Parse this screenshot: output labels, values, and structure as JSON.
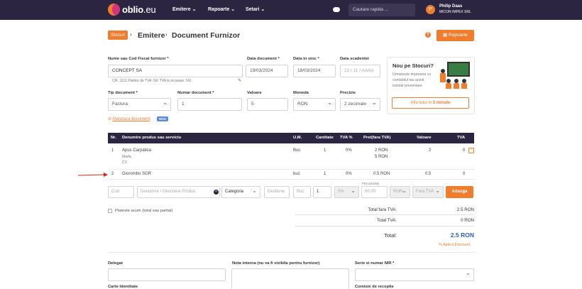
{
  "app": {
    "name": "oblio",
    "tld": ".eu"
  },
  "nav": {
    "items": [
      "Emitere",
      "Rapoarte",
      "Setari"
    ]
  },
  "search": {
    "placeholder": "Cautare rapida ..."
  },
  "user": {
    "initial": "P",
    "name": "Philip Daas",
    "company": "MICON IMPEX SRL"
  },
  "breadcrumb": {
    "badge": "Stocuri",
    "level1": "Emitere",
    "level2": "Document Furnizor"
  },
  "header": {
    "reports_button": "Rapoarte",
    "help": "?"
  },
  "form": {
    "supplier_label": "Nume sau Cod Fiscal furnizor *",
    "supplier_value": "CONCEPT SA",
    "supplier_hint": "CIF: 1111   Platitor de TVA: NU   TVA la incasare: NU",
    "doc_date_label": "Data document *",
    "doc_date_value": "19/03/2024",
    "stock_date_label": "Data in stoc *",
    "stock_date_value": "18/03/2024",
    "due_date_label": "Data scadentei",
    "due_date_placeholder": "22 / 11 / AAAA",
    "doc_type_label": "Tip document *",
    "doc_type_value": "Factura",
    "doc_number_label": "Numar document *",
    "doc_number_value": "1",
    "value_label": "Valoare",
    "value_value": "5",
    "currency_label": "Moneda",
    "currency_value": "RON",
    "precision_label": "Precizie",
    "precision_value": "2 zecimale"
  },
  "promo": {
    "title": "Nou pe Stocuri?",
    "text": "Urmareste impreuna cu contabilul tau acest tutorial prezentare",
    "button_prefix": "Afla totul in",
    "button_highlight": "5 minute"
  },
  "attach": {
    "label": "Ataseaza document",
    "badge": "NOU"
  },
  "table": {
    "headers": [
      "Nr.",
      "Denumire produs sau serviciu",
      "U.M.",
      "Cantitate",
      "TVA %",
      "Pret(fara TVA)",
      "Valoare",
      "TVA"
    ],
    "rows": [
      {
        "nr": "1",
        "name": "Apus Carpatica",
        "details": [
          "Marfa",
          "CV"
        ],
        "um": "Buc",
        "qty": "1",
        "vat_pct": "0%",
        "price": "2 RON",
        "price2": "5 RON",
        "value": "2",
        "vat": "0"
      },
      {
        "nr": "2",
        "name": "Giorombo SGR",
        "details": [],
        "um": "buc",
        "qty": "1",
        "vat_pct": "0%",
        "price": "0.5 RON",
        "price2": "",
        "value": "0.5",
        "vat": "0"
      }
    ]
  },
  "entry": {
    "code": "Cod",
    "name": "Denumire / Descriere Produs",
    "category": "Categoria",
    "warehouse": "Gestiune",
    "um": "Buc",
    "qty": "1",
    "vat": "0%",
    "price_label": "Pret achizitie",
    "price": "00.00",
    "currency": "RON",
    "vat_mode": "Fara TVA",
    "add_button": "Adauga"
  },
  "payment": {
    "checkbox_label": "Plateste acum (total sau partial)"
  },
  "totals": {
    "no_vat_label": "Total fara TVA:",
    "no_vat_value": "2.5 RON",
    "vat_label": "Total TVA:",
    "vat_value": "0 RON",
    "total_label": "Total:",
    "total_value": "2.5 RON",
    "discount_label": "% Aplica Discount"
  },
  "bottom": {
    "delegate_label": "Delegat",
    "id_label": "Carte Identitate",
    "note_label": "Nota interna (nu va fi vizibila pentru furnizor)",
    "nir_label": "Serie si numar NIR *",
    "committee_label": "Comisie de receptie"
  },
  "colors": {
    "accent": "#ef7d2d",
    "navbar": "#2c2541",
    "badge": "#5b8ad8",
    "arrow": "#d9261c"
  }
}
